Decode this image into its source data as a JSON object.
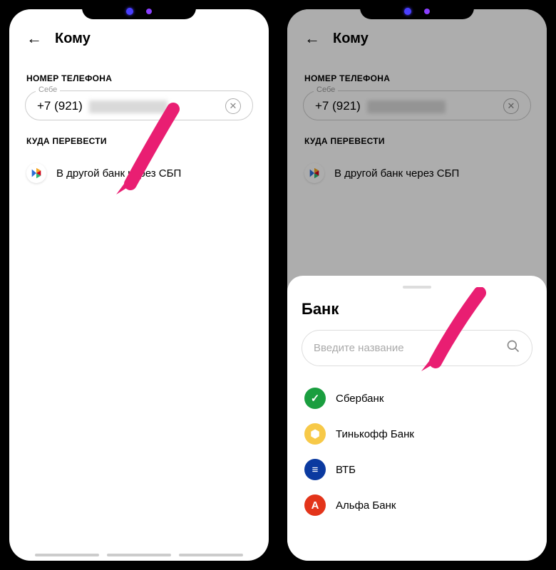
{
  "left": {
    "header_title": "Кому",
    "phone_section_label": "НОМЕР ТЕЛЕФОНА",
    "phone_legend": "Себе",
    "phone_value_prefix": "+7 (921)",
    "dest_section_label": "КУДА ПЕРЕВЕСТИ",
    "dest_option": "В другой банк через СБП"
  },
  "right": {
    "header_title": "Кому",
    "phone_section_label": "НОМЕР ТЕЛЕФОНА",
    "phone_legend": "Себе",
    "phone_value_prefix": "+7 (921)",
    "dest_section_label": "КУДА ПЕРЕВЕСТИ",
    "dest_option": "В другой банк через СБП",
    "sheet": {
      "title": "Банк",
      "search_placeholder": "Введите название",
      "banks": [
        {
          "name": "Сбербанк",
          "color": "#1a9e3f",
          "glyph": "✓"
        },
        {
          "name": "Тинькофф Банк",
          "color": "#f7c948",
          "glyph": "⬢"
        },
        {
          "name": "ВТБ",
          "color": "#0b3aa0",
          "glyph": "≡"
        },
        {
          "name": "Альфа Банк",
          "color": "#e3341a",
          "glyph": "A"
        }
      ]
    }
  }
}
